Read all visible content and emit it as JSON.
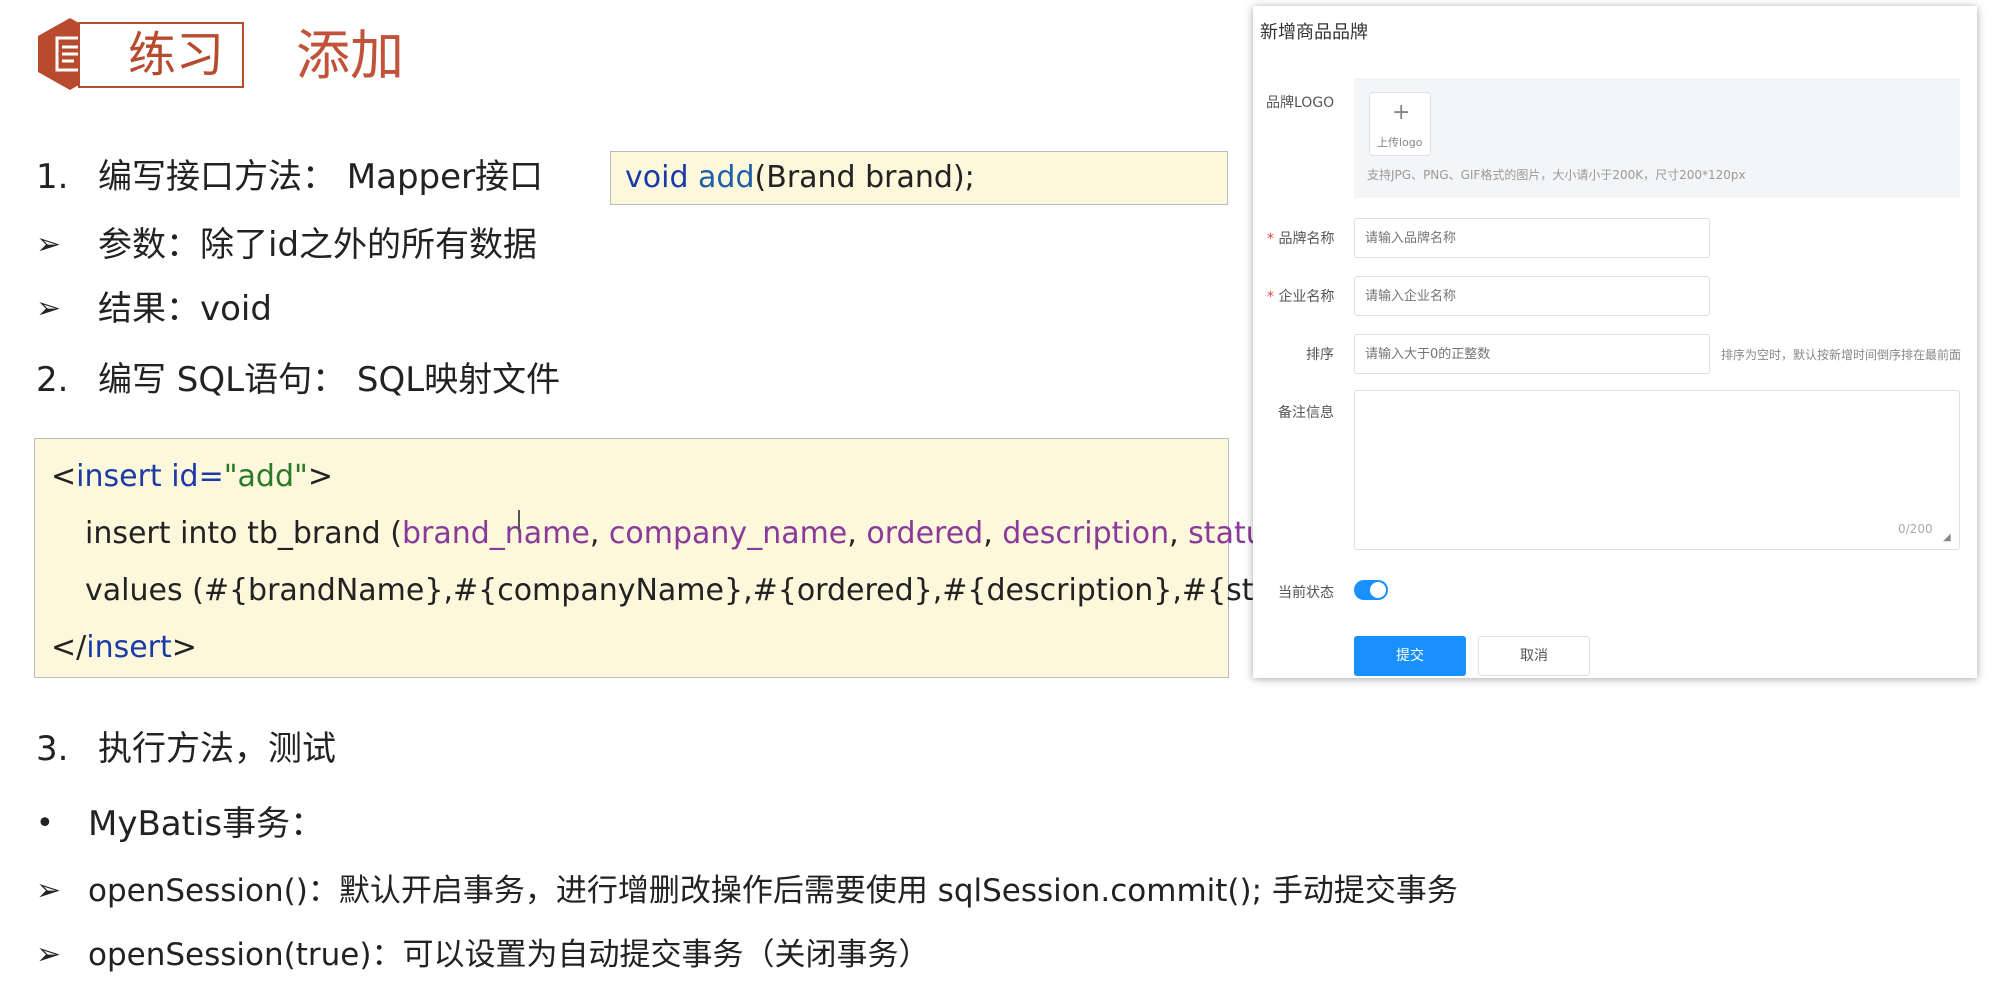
{
  "header": {
    "tag": "练习",
    "title": "添加"
  },
  "steps": {
    "step1": {
      "num": "1.",
      "text": "编写接口方法： Mapper接口"
    },
    "param": "参数：除了id之外的所有数据",
    "result": "结果：void",
    "step2": {
      "num": "2.",
      "text": "编写 SQL语句： SQL映射文件"
    },
    "step3": {
      "num": "3.",
      "text": "执行方法，测试"
    }
  },
  "code_inline": {
    "kw": "void",
    "fn": "add",
    "rest": "(Brand brand);"
  },
  "code_block": {
    "line1": {
      "open": "<",
      "tag": "insert",
      "attr": " id=",
      "value": "\"add\"",
      "close": ">"
    },
    "line2": {
      "prefix": "insert into tb_brand (",
      "columns": [
        "brand_name",
        "company_name",
        "ordered",
        "description",
        "status"
      ],
      "sep": ", ",
      "suffix": ")"
    },
    "line3": "values (#{brandName},#{companyName},#{ordered},#{description},#{status});",
    "line4": {
      "open": "</",
      "tag": "insert",
      "close": ">"
    }
  },
  "notes": {
    "mybatis": "MyBatis事务：",
    "session1": "openSession()：默认开启事务，进行增删改操作后需要使用 sqlSession.commit(); 手动提交事务",
    "session2": "openSession(true)：可以设置为自动提交事务（关闭事务）"
  },
  "bullets": {
    "arrow": "➢",
    "dot": "•"
  },
  "form": {
    "title": "新增商品品牌",
    "logo_label": "品牌LOGO",
    "upload_plus": "+",
    "upload_text": "上传logo",
    "logo_tip": "支持JPG、PNG、GIF格式的图片，大小请小于200K，尺寸200*120px",
    "required_mark": "*",
    "brand_label": "品牌名称",
    "brand_placeholder": "请输入品牌名称",
    "company_label": "企业名称",
    "company_placeholder": "请输入企业名称",
    "sort_label": "排序",
    "sort_placeholder": "请输入大于0的正整数",
    "sort_tip": "排序为空时，默认按新增时间倒序排在最前面",
    "remark_label": "备注信息",
    "remark_count": "0/200",
    "status_label": "当前状态",
    "status_on": true,
    "submit": "提交",
    "cancel": "取消"
  },
  "colors": {
    "accent": "#c0533a",
    "primary": "#1890ff",
    "code_bg": "#fdf8dc"
  }
}
